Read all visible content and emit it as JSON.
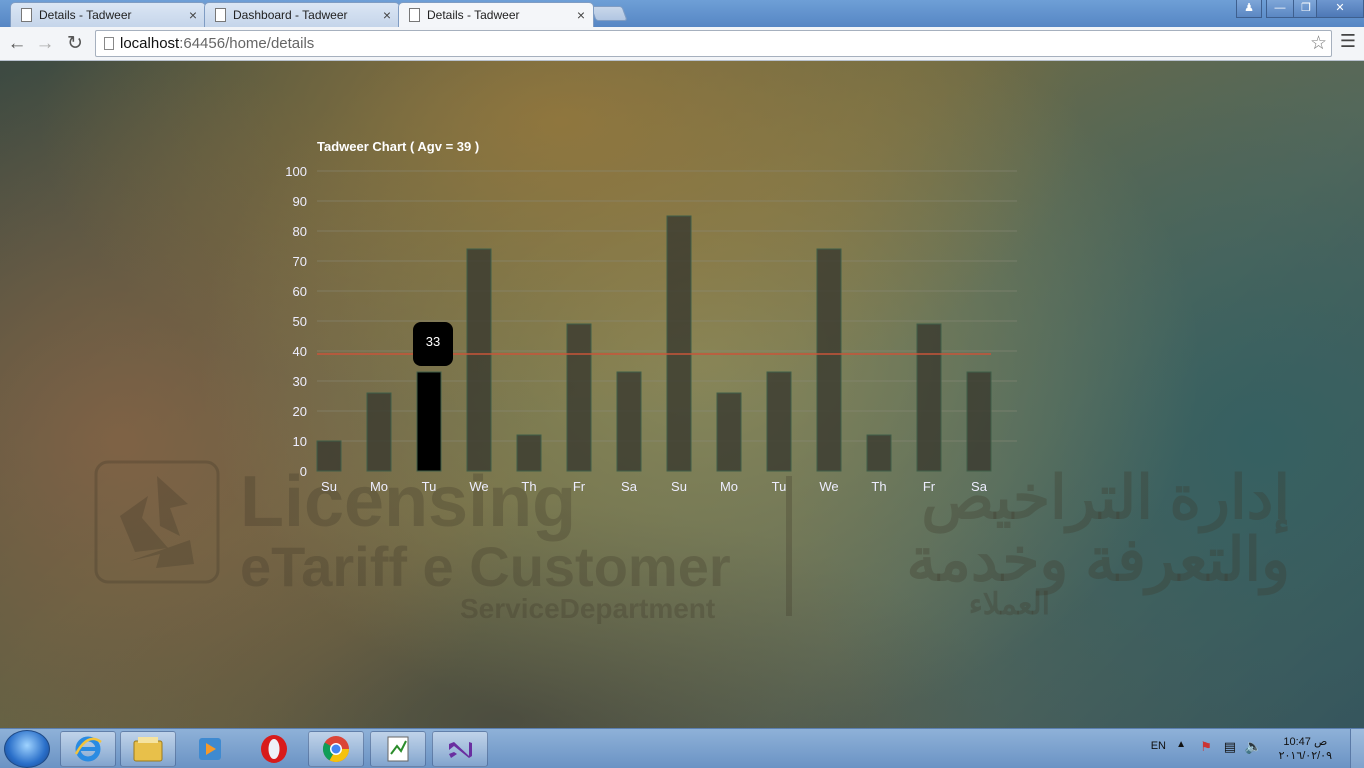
{
  "browser": {
    "tabs": [
      {
        "label": "Details - Tadweer"
      },
      {
        "label": "Dashboard - Tadweer"
      },
      {
        "label": "Details - Tadweer"
      }
    ],
    "close_glyph": "×",
    "url_host": "localhost",
    "url_rest": ":64456/home/details"
  },
  "chart_data": {
    "type": "bar",
    "title": "Tadweer Chart ( Agv = 39 )",
    "categories": [
      "Su",
      "Mo",
      "Tu",
      "We",
      "Th",
      "Fr",
      "Sa",
      "Su",
      "Mo",
      "Tu",
      "We",
      "Th",
      "Fr",
      "Sa"
    ],
    "values": [
      10,
      26,
      33,
      74,
      12,
      49,
      33,
      85,
      26,
      33,
      74,
      12,
      49,
      33
    ],
    "average": 39,
    "ylim": [
      0,
      100
    ],
    "yticks": [
      0,
      10,
      20,
      30,
      40,
      50,
      60,
      70,
      80,
      90,
      100
    ],
    "grid": true,
    "highlighted_index": 2,
    "tooltip_value": "33",
    "colors": {
      "bar": "#3a3a30",
      "bar_highlight": "#000000",
      "bar_stroke": "#3f5e48",
      "average_line": "#c8553a",
      "grid": "#8a8a7a"
    }
  },
  "watermark": {
    "line1": "Licensing",
    "line2": "eTariff e Customer",
    "line3": "ServiceDepartment",
    "arabic1": "إدارة التراخيص",
    "arabic2": "والتعرفة وخدمة",
    "arabic3": "العملاء"
  },
  "taskbar": {
    "apps": [
      "ie-icon",
      "explorer-icon",
      "media-player-icon",
      "opera-icon",
      "chrome-icon",
      "notepad-icon",
      "visual-studio-icon"
    ],
    "lang": "EN",
    "time": "ص 10:47",
    "date": "٢٠١٦/٠٢/٠٩"
  }
}
